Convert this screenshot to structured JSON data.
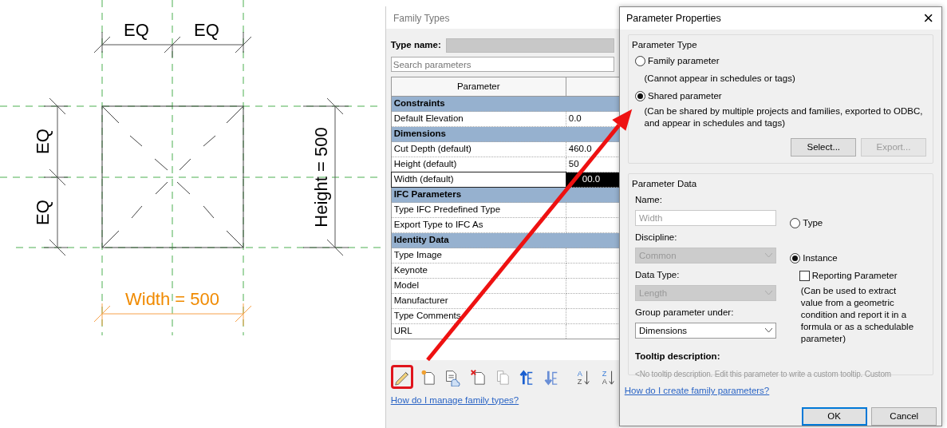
{
  "drawing": {
    "top_labels": [
      "EQ",
      "EQ"
    ],
    "left_labels": [
      "EQ",
      "EQ"
    ],
    "height_label": "Height = 500",
    "width_label": "Width = 500"
  },
  "family_types": {
    "title": "Family Types",
    "type_name_label": "Type name:",
    "search": {
      "placeholder": "Search parameters"
    },
    "columns": [
      "Parameter"
    ],
    "rows": [
      {
        "kind": "group",
        "name": "Constraints",
        "selected": false
      },
      {
        "kind": "param",
        "name": "Default Elevation",
        "value": "0.0",
        "selected": false
      },
      {
        "kind": "group",
        "name": "Dimensions",
        "selected": false
      },
      {
        "kind": "param",
        "name": "Cut Depth (default)",
        "value": "460.0",
        "selected": false
      },
      {
        "kind": "param",
        "name": "Height (default)",
        "value": "50",
        "selected": false
      },
      {
        "kind": "param",
        "name": "Width (default)",
        "value": "00.0",
        "selected": true
      },
      {
        "kind": "group",
        "name": "IFC Parameters",
        "selected": false
      },
      {
        "kind": "param",
        "name": "Type IFC Predefined Type",
        "value": "",
        "selected": false
      },
      {
        "kind": "param",
        "name": "Export Type to IFC As",
        "value": "",
        "selected": false
      },
      {
        "kind": "group",
        "name": "Identity Data",
        "selected": false
      },
      {
        "kind": "param",
        "name": "Type Image",
        "value": "",
        "selected": false
      },
      {
        "kind": "param",
        "name": "Keynote",
        "value": "",
        "selected": false
      },
      {
        "kind": "param",
        "name": "Model",
        "value": "",
        "selected": false
      },
      {
        "kind": "param",
        "name": "Manufacturer",
        "value": "",
        "selected": false
      },
      {
        "kind": "param",
        "name": "Type Comments",
        "value": "",
        "selected": false
      },
      {
        "kind": "param",
        "name": "URL",
        "value": "",
        "selected": false
      }
    ],
    "toolbar": [
      {
        "highlighted": true
      },
      {
        "highlighted": false
      },
      {
        "highlighted": false
      },
      {
        "highlighted": false
      },
      {
        "highlighted": false
      },
      {
        "highlighted": false
      },
      {
        "highlighted": false
      },
      {
        "highlighted": false,
        "letters": [
          "A",
          "Z"
        ]
      },
      {
        "highlighted": false,
        "letters": [
          "Z",
          "A"
        ]
      }
    ],
    "help_link": "How do I manage family types?"
  },
  "parameter_properties": {
    "title": "Parameter Properties",
    "close": "×",
    "parameter_type": {
      "legend": "Parameter Type",
      "options": [
        {
          "label": "Family parameter",
          "note": "(Cannot appear in schedules or tags)",
          "selected": false
        },
        {
          "label": "Shared parameter",
          "note": "(Can be shared by multiple projects and families, exported to ODBC, and appear in schedules and tags)",
          "selected": true
        }
      ],
      "buttons": [
        {
          "label": "Select...",
          "disabled": false
        },
        {
          "label": "Export...",
          "disabled": true
        }
      ]
    },
    "parameter_data": {
      "legend": "Parameter Data",
      "fields": [
        {
          "kind": "text",
          "label": "Name:",
          "value": "Width",
          "disabled": true
        },
        {
          "kind": "select",
          "label": "Discipline:",
          "value": "Common",
          "disabled": true
        },
        {
          "kind": "select",
          "label": "Data Type:",
          "value": "Length",
          "disabled": true
        },
        {
          "kind": "select",
          "label": "Group parameter under:",
          "value": "Dimensions",
          "disabled": false
        }
      ],
      "scope": [
        {
          "label": "Type",
          "selected": false
        },
        {
          "label": "Instance",
          "selected": true
        }
      ],
      "reporting": {
        "label": "Reporting Parameter",
        "checked": false,
        "note": "(Can be used to extract value from a geometric condition and report it in a formula or as a schedulable parameter)"
      },
      "tooltip_label": "Tooltip description:",
      "tooltip_text": "<No tooltip description. Edit this parameter to write a custom tooltip. Custom"
    },
    "help_link": "How do I create family parameters?",
    "buttons": [
      {
        "label": "OK",
        "default": true
      },
      {
        "label": "Cancel",
        "default": false
      }
    ]
  }
}
